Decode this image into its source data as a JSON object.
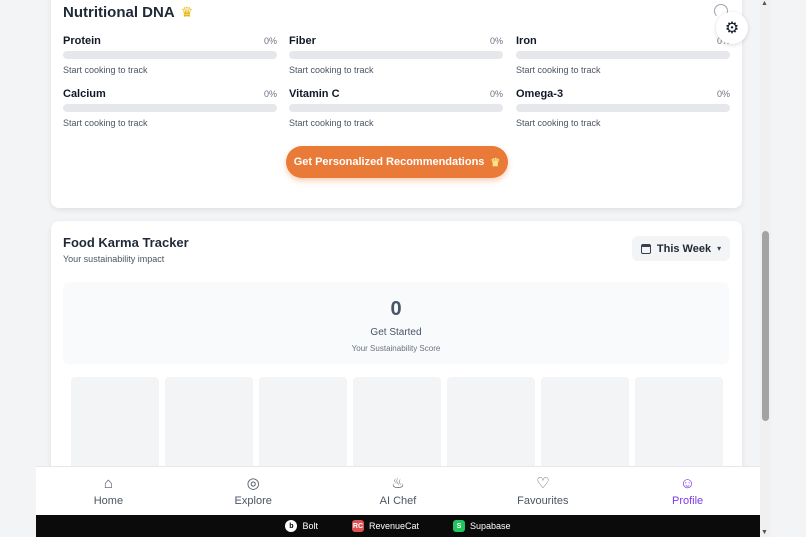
{
  "nutritional_dna": {
    "title": "Nutritional DNA",
    "nutrients": [
      {
        "name": "Protein",
        "percent": "0%",
        "status": "Start cooking to track",
        "fill": 0
      },
      {
        "name": "Fiber",
        "percent": "0%",
        "status": "Start cooking to track",
        "fill": 0
      },
      {
        "name": "Iron",
        "percent": "0%",
        "status": "Start cooking to track",
        "fill": 0
      },
      {
        "name": "Calcium",
        "percent": "0%",
        "status": "Start cooking to track",
        "fill": 0
      },
      {
        "name": "Vitamin C",
        "percent": "0%",
        "status": "Start cooking to track",
        "fill": 0
      },
      {
        "name": "Omega-3",
        "percent": "0%",
        "status": "Start cooking to track",
        "fill": 0
      }
    ],
    "cta_label": "Get Personalized Recommendations"
  },
  "food_karma": {
    "title": "Food Karma Tracker",
    "subtitle": "Your sustainability impact",
    "period": "This Week",
    "score": "0",
    "score_label": "Get Started",
    "score_sub": "Your Sustainability Score"
  },
  "tabs": [
    {
      "label": "Home",
      "icon": "home-icon",
      "active": false
    },
    {
      "label": "Explore",
      "icon": "compass-icon",
      "active": false
    },
    {
      "label": "AI Chef",
      "icon": "chef-hat-icon",
      "active": false
    },
    {
      "label": "Favourites",
      "icon": "heart-icon",
      "active": false
    },
    {
      "label": "Profile",
      "icon": "user-icon",
      "active": true
    }
  ],
  "badges": [
    {
      "label": "Bolt",
      "icon": "bolt-logo",
      "glyph": "b"
    },
    {
      "label": "RevenueCat",
      "icon": "revenuecat-logo",
      "glyph": "RC"
    },
    {
      "label": "Supabase",
      "icon": "supabase-logo",
      "glyph": "S"
    }
  ],
  "colors": {
    "accent": "#ea7a38",
    "active_tab": "#7c3aed"
  }
}
